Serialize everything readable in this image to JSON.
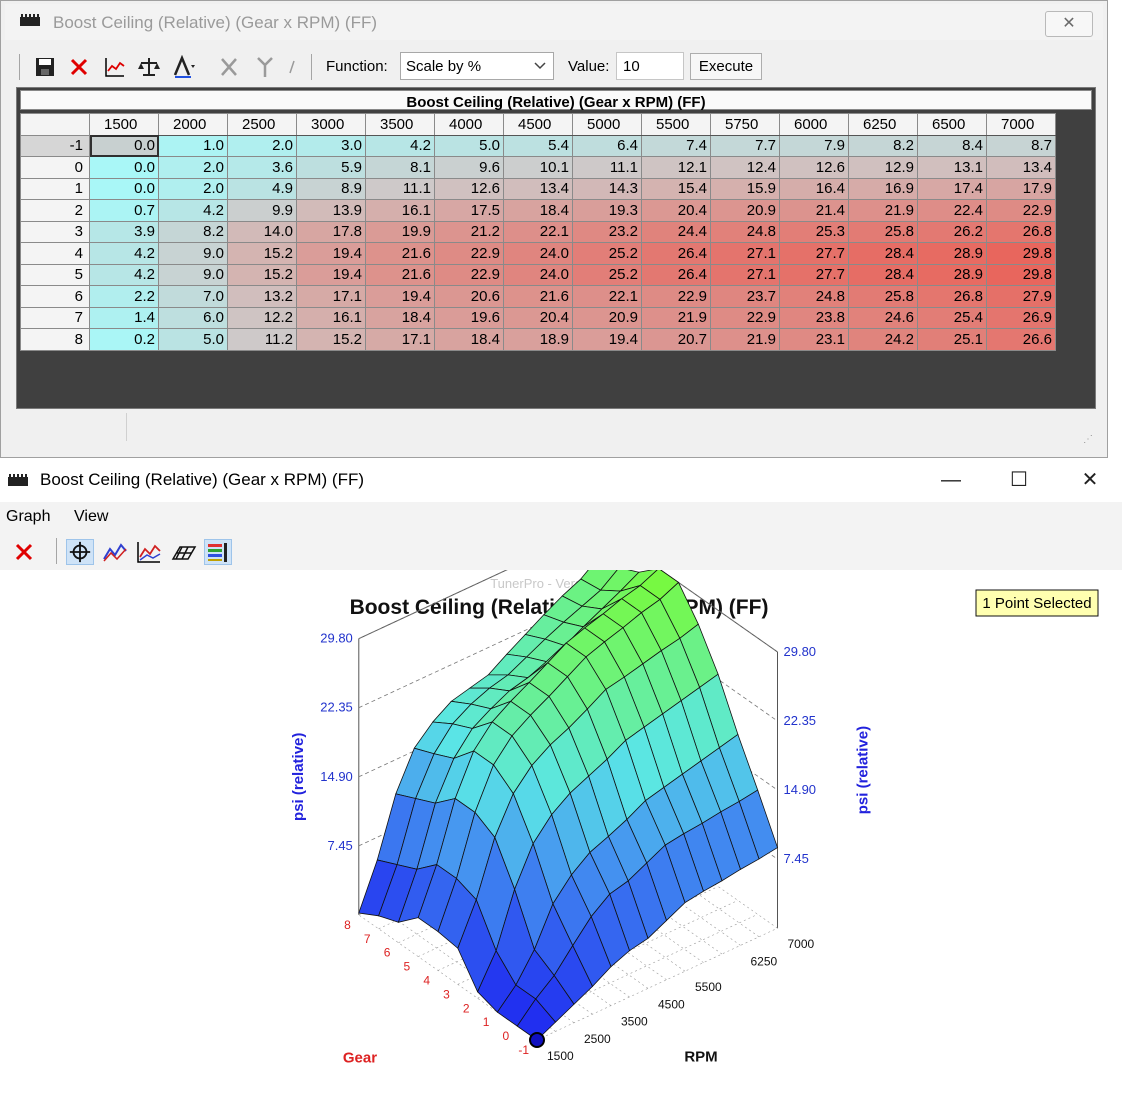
{
  "editor": {
    "title": "Boost Ceiling (Relative) (Gear x RPM) (FF)",
    "close_glyph": "✕",
    "toolbar": {
      "icons": [
        "save-icon",
        "delete-icon",
        "graph-icon",
        "scale-icon",
        "text-icon",
        "cut-icon",
        "split-icon",
        "more-icon"
      ],
      "function_label": "Function:",
      "function_value": "Scale by %",
      "value_label": "Value:",
      "value": "10",
      "execute_label": "Execute"
    },
    "table": {
      "title": "Boost Ceiling (Relative) (Gear x RPM) (FF)",
      "columns": [
        "1500",
        "2000",
        "2500",
        "3000",
        "3500",
        "4000",
        "4500",
        "5000",
        "5500",
        "5750",
        "6000",
        "6250",
        "6500",
        "7000"
      ],
      "rows": [
        {
          "label": "-1",
          "values": [
            "0.0",
            "1.0",
            "2.0",
            "3.0",
            "4.2",
            "5.0",
            "5.4",
            "6.4",
            "7.4",
            "7.7",
            "7.9",
            "8.2",
            "8.4",
            "8.7"
          ]
        },
        {
          "label": "0",
          "values": [
            "0.0",
            "2.0",
            "3.6",
            "5.9",
            "8.1",
            "9.6",
            "10.1",
            "11.1",
            "12.1",
            "12.4",
            "12.6",
            "12.9",
            "13.1",
            "13.4"
          ]
        },
        {
          "label": "1",
          "values": [
            "0.0",
            "2.0",
            "4.9",
            "8.9",
            "11.1",
            "12.6",
            "13.4",
            "14.3",
            "15.4",
            "15.9",
            "16.4",
            "16.9",
            "17.4",
            "17.9"
          ]
        },
        {
          "label": "2",
          "values": [
            "0.7",
            "4.2",
            "9.9",
            "13.9",
            "16.1",
            "17.5",
            "18.4",
            "19.3",
            "20.4",
            "20.9",
            "21.4",
            "21.9",
            "22.4",
            "22.9"
          ]
        },
        {
          "label": "3",
          "values": [
            "3.9",
            "8.2",
            "14.0",
            "17.8",
            "19.9",
            "21.2",
            "22.1",
            "23.2",
            "24.4",
            "24.8",
            "25.3",
            "25.8",
            "26.2",
            "26.8"
          ]
        },
        {
          "label": "4",
          "values": [
            "4.2",
            "9.0",
            "15.2",
            "19.4",
            "21.6",
            "22.9",
            "24.0",
            "25.2",
            "26.4",
            "27.1",
            "27.7",
            "28.4",
            "28.9",
            "29.8"
          ]
        },
        {
          "label": "5",
          "values": [
            "4.2",
            "9.0",
            "15.2",
            "19.4",
            "21.6",
            "22.9",
            "24.0",
            "25.2",
            "26.4",
            "27.1",
            "27.7",
            "28.4",
            "28.9",
            "29.8"
          ]
        },
        {
          "label": "6",
          "values": [
            "2.2",
            "7.0",
            "13.2",
            "17.1",
            "19.4",
            "20.6",
            "21.6",
            "22.1",
            "22.9",
            "23.7",
            "24.8",
            "25.8",
            "26.8",
            "27.9"
          ]
        },
        {
          "label": "7",
          "values": [
            "1.4",
            "6.0",
            "12.2",
            "16.1",
            "18.4",
            "19.6",
            "20.4",
            "20.9",
            "21.9",
            "22.9",
            "23.8",
            "24.6",
            "25.4",
            "26.9"
          ]
        },
        {
          "label": "8",
          "values": [
            "0.2",
            "5.0",
            "11.2",
            "15.2",
            "17.1",
            "18.4",
            "18.9",
            "19.4",
            "20.7",
            "21.9",
            "23.1",
            "24.2",
            "25.1",
            "26.6"
          ]
        }
      ],
      "color_low": "#a9f7f7",
      "color_mid": "#cdcdcd",
      "color_high": "#e8665d"
    }
  },
  "graph_window": {
    "title": "Boost Ceiling (Relative) (Gear x RPM) (FF)",
    "controls": {
      "minimize": "—",
      "maximize": "☐",
      "close": "✕"
    },
    "menu": [
      "Graph",
      "View"
    ],
    "toolbar_icons": [
      "delete-icon",
      "move-icon",
      "line-graph-icon",
      "area-graph-icon",
      "surface-icon",
      "legend-icon"
    ],
    "watermark": "TunerPro - Version 5.00",
    "chart_title": "Boost Ceiling (Relative) (Gear x RPM) (FF)",
    "selection_badge": "1 Point Selected",
    "z_axis_label": "psi (relative)",
    "z_ticks": [
      "7.45",
      "14.90",
      "22.35",
      "29.80"
    ],
    "x_axis_label": "Gear",
    "x_ticks": [
      "-1",
      "0",
      "1",
      "2",
      "3",
      "4",
      "5",
      "6",
      "7",
      "8"
    ],
    "y_axis_label": "RPM",
    "y_ticks": [
      "1500",
      "2500",
      "3500",
      "4500",
      "5500",
      "6250",
      "7000"
    ]
  },
  "chart_data": {
    "type": "surface",
    "title": "Boost Ceiling (Relative) (Gear x RPM) (FF)",
    "x_label": "Gear",
    "y_label": "RPM",
    "z_label": "psi (relative)",
    "zlim": [
      0,
      29.8
    ],
    "x": [
      -1,
      0,
      1,
      2,
      3,
      4,
      5,
      6,
      7,
      8
    ],
    "y": [
      1500,
      2000,
      2500,
      3000,
      3500,
      4000,
      4500,
      5000,
      5500,
      5750,
      6000,
      6250,
      6500,
      7000
    ],
    "z": [
      [
        0.0,
        1.0,
        2.0,
        3.0,
        4.2,
        5.0,
        5.4,
        6.4,
        7.4,
        7.7,
        7.9,
        8.2,
        8.4,
        8.7
      ],
      [
        0.0,
        2.0,
        3.6,
        5.9,
        8.1,
        9.6,
        10.1,
        11.1,
        12.1,
        12.4,
        12.6,
        12.9,
        13.1,
        13.4
      ],
      [
        0.0,
        2.0,
        4.9,
        8.9,
        11.1,
        12.6,
        13.4,
        14.3,
        15.4,
        15.9,
        16.4,
        16.9,
        17.4,
        17.9
      ],
      [
        0.7,
        4.2,
        9.9,
        13.9,
        16.1,
        17.5,
        18.4,
        19.3,
        20.4,
        20.9,
        21.4,
        21.9,
        22.4,
        22.9
      ],
      [
        3.9,
        8.2,
        14.0,
        17.8,
        19.9,
        21.2,
        22.1,
        23.2,
        24.4,
        24.8,
        25.3,
        25.8,
        26.2,
        26.8
      ],
      [
        4.2,
        9.0,
        15.2,
        19.4,
        21.6,
        22.9,
        24.0,
        25.2,
        26.4,
        27.1,
        27.7,
        28.4,
        28.9,
        29.8
      ],
      [
        4.2,
        9.0,
        15.2,
        19.4,
        21.6,
        22.9,
        24.0,
        25.2,
        26.4,
        27.1,
        27.7,
        28.4,
        28.9,
        29.8
      ],
      [
        2.2,
        7.0,
        13.2,
        17.1,
        19.4,
        20.6,
        21.6,
        22.1,
        22.9,
        23.7,
        24.8,
        25.8,
        26.8,
        27.9
      ],
      [
        1.4,
        6.0,
        12.2,
        16.1,
        18.4,
        19.6,
        20.4,
        20.9,
        21.9,
        22.9,
        23.8,
        24.6,
        25.4,
        26.9
      ],
      [
        0.2,
        5.0,
        11.2,
        15.2,
        17.1,
        18.4,
        18.9,
        19.4,
        20.7,
        21.9,
        23.1,
        24.2,
        25.1,
        26.6
      ]
    ]
  }
}
